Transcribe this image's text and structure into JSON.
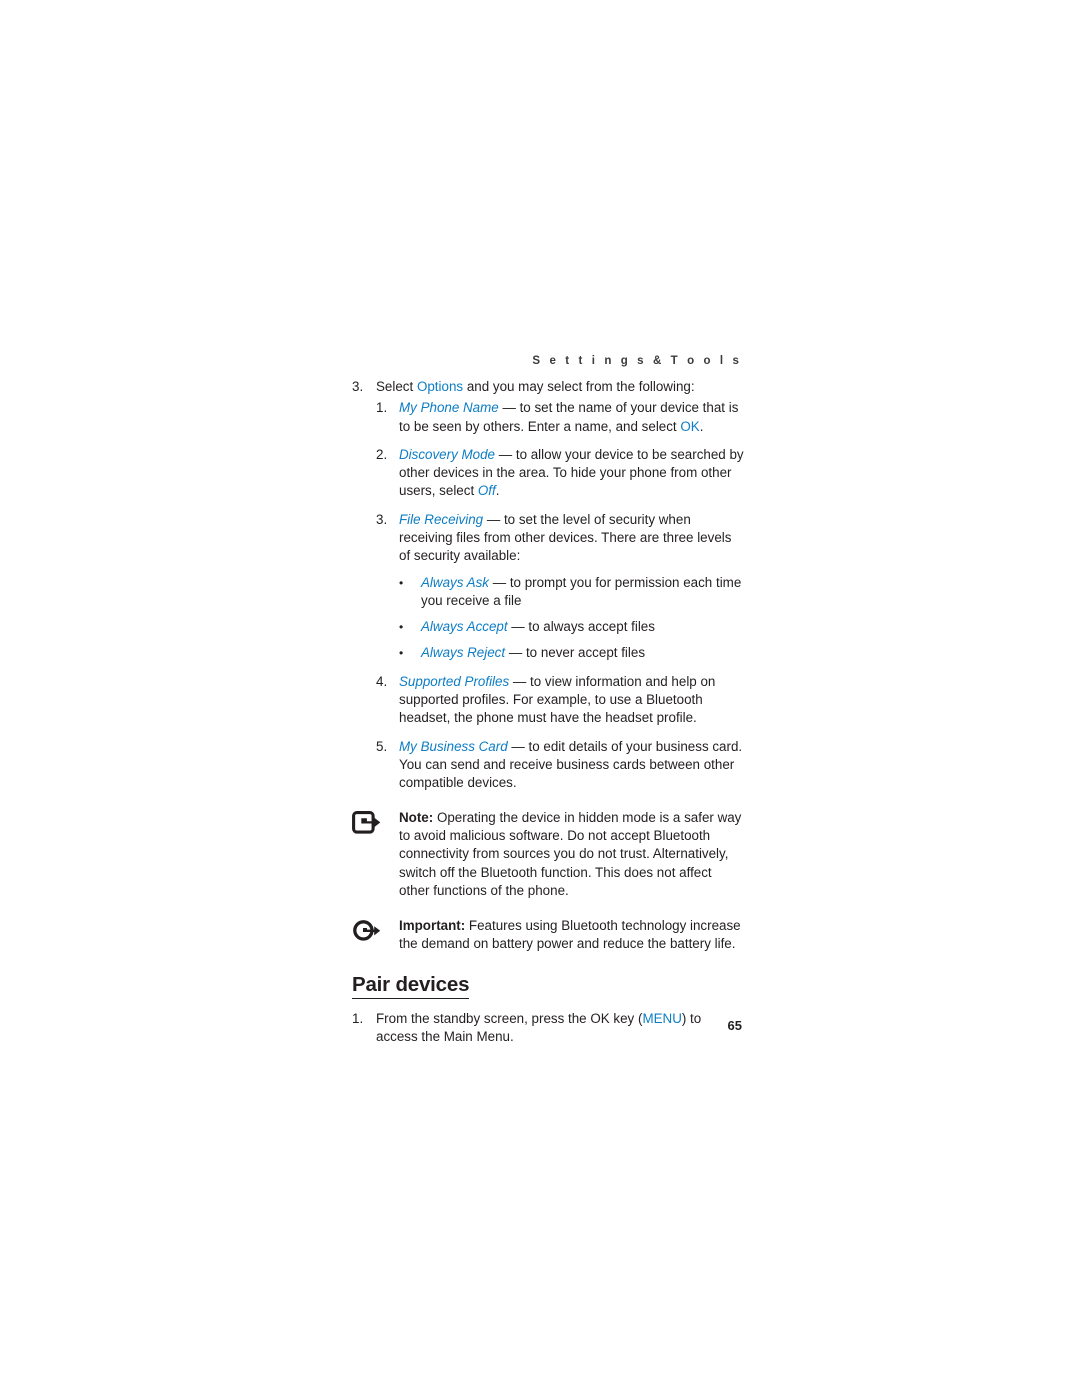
{
  "header": {
    "running_head": "S e t t i n g s   &   T o o l s"
  },
  "folio": {
    "page_number": "65"
  },
  "colors": {
    "link_blue": "#0d7dc4",
    "text": "#231f20",
    "header_gray": "#3b3b3b"
  },
  "content": {
    "step3": {
      "marker": "3.",
      "pre": "Select ",
      "keyword": "Options",
      "post": " and you may select from the following:"
    },
    "options": [
      {
        "marker": "1.",
        "term": "My Phone Name",
        "dash": " — ",
        "text": "to set the name of your device that is to be seen by others. Enter a name, and select ",
        "keyword": "OK",
        "tail": "."
      },
      {
        "marker": "2.",
        "term": "Discovery Mode",
        "dash": " — ",
        "text": "to allow your device to be searched by other devices in the area. To hide your phone from other users, select ",
        "keyword_italic": "Off",
        "tail": "."
      },
      {
        "marker": "3.",
        "term": "File Receiving",
        "dash": " — ",
        "text": "to set the level of security when receiving files from other devices. There are three levels of security available:",
        "tail": ""
      },
      {
        "marker": "4.",
        "term": "Supported Profiles",
        "dash": " — ",
        "text": "to view information and help on supported profiles. For example, to use a Bluetooth headset, the phone must have the headset profile.",
        "tail": ""
      },
      {
        "marker": "5.",
        "term": "My Business Card",
        "dash": " — ",
        "text": "to edit details of your business card. You can send and receive business cards between other compatible devices.",
        "tail": ""
      }
    ],
    "security_levels": [
      {
        "marker": "•",
        "term": "Always Ask",
        "dash": " — ",
        "text": "to prompt you for permission each time you receive a file"
      },
      {
        "marker": "•",
        "term": "Always Accept",
        "dash": " — ",
        "text": "to always accept files"
      },
      {
        "marker": "•",
        "term": "Always Reject",
        "dash": " — ",
        "text": "to never accept files"
      }
    ],
    "note": {
      "icon": "note-arrow-icon",
      "label": "Note:",
      "text": " Operating the device in hidden mode is a safer way to avoid malicious software. Do not accept Bluetooth connectivity from sources you do not trust. Alternatively, switch off the Bluetooth function. This does not affect other functions of the phone."
    },
    "important": {
      "icon": "important-arrow-icon",
      "label": "Important:",
      "text": " Features using Bluetooth technology increase the demand on battery power and reduce the battery life."
    },
    "section": {
      "heading": "Pair devices",
      "steps": [
        {
          "marker": "1.",
          "pre": "From the standby screen, press the OK key (",
          "keyword": "MENU",
          "post": ") to access the Main Menu."
        }
      ]
    }
  }
}
